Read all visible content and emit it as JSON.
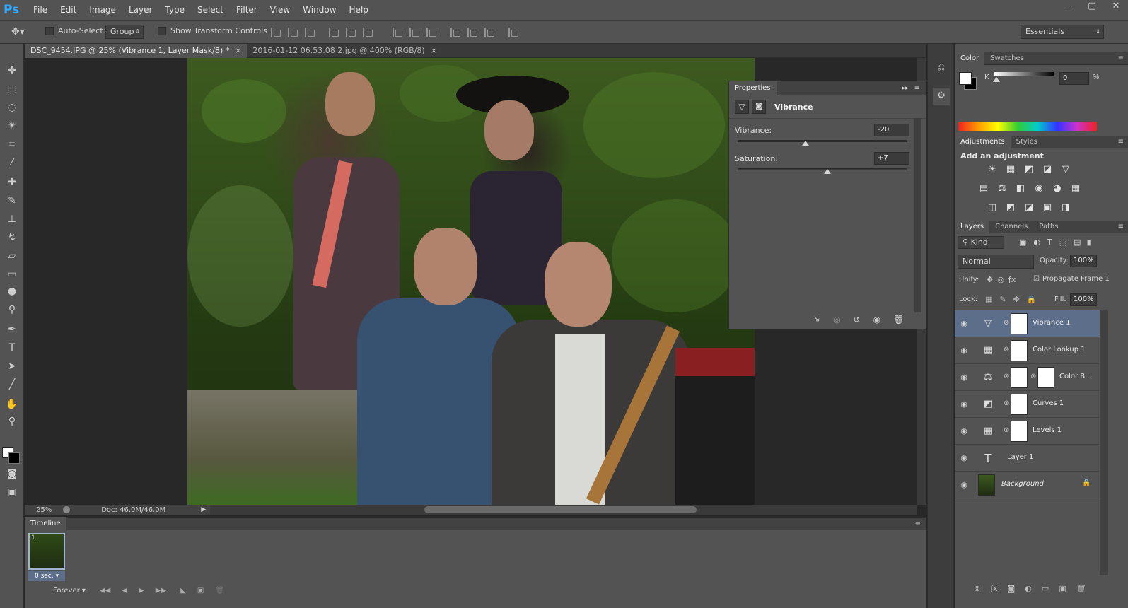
{
  "app": {
    "logo": "Ps"
  },
  "menu": [
    "File",
    "Edit",
    "Image",
    "Layer",
    "Type",
    "Select",
    "Filter",
    "View",
    "Window",
    "Help"
  ],
  "window_controls": {
    "minimize": "–",
    "restore": "▢",
    "close": "✕"
  },
  "options_bar": {
    "auto_select_label": "Auto-Select:",
    "auto_select_value": "Group",
    "show_transform_label": "Show Transform Controls",
    "workspace": "Essentials"
  },
  "documents": [
    {
      "title": "DSC_9454.JPG @ 25% (Vibrance 1, Layer Mask/8) *",
      "active": true
    },
    {
      "title": "2016-01-12 06.53.08 2.jpg @ 400% (RGB/8)",
      "active": false
    }
  ],
  "status": {
    "zoom": "25%",
    "doc": "Doc: 46.0M/46.0M"
  },
  "properties": {
    "tab": "Properties",
    "title": "Vibrance",
    "vibrance_label": "Vibrance:",
    "vibrance_value": "-20",
    "saturation_label": "Saturation:",
    "saturation_value": "+7"
  },
  "timeline": {
    "tab": "Timeline",
    "frame_number": "1",
    "frame_delay": "0 sec.",
    "loop": "Forever"
  },
  "color_panel": {
    "tabs": [
      "Color",
      "Swatches"
    ],
    "channel_label": "K",
    "channel_value": "0",
    "unit": "%"
  },
  "adjustments_panel": {
    "tabs": [
      "Adjustments",
      "Styles"
    ],
    "heading": "Add an adjustment",
    "row1": [
      "☀",
      "▦",
      "◩",
      "◪",
      "▽"
    ],
    "row2": [
      "▤",
      "⚖",
      "◧",
      "◉",
      "◕",
      "▦"
    ],
    "row3": [
      "◫",
      "◩",
      "◪",
      "▣",
      "◨"
    ]
  },
  "layers_panel": {
    "tabs": [
      "Layers",
      "Channels",
      "Paths"
    ],
    "filter_kind": "Kind",
    "blend_mode": "Normal",
    "opacity_label": "Opacity:",
    "opacity_value": "100%",
    "unify_label": "Unify:",
    "propagate_label": "Propagate Frame 1",
    "lock_label": "Lock:",
    "fill_label": "Fill:",
    "fill_value": "100%",
    "layers": [
      {
        "name": "Vibrance 1",
        "icon": "▽",
        "selected": true
      },
      {
        "name": "Color Lookup 1",
        "icon": "▦",
        "selected": false
      },
      {
        "name": "Color B...",
        "icon": "⚖",
        "selected": false
      },
      {
        "name": "Curves 1",
        "icon": "◩",
        "selected": false
      },
      {
        "name": "Levels 1",
        "icon": "▦",
        "selected": false
      },
      {
        "name": "Layer 1",
        "icon": "T",
        "selected": false
      },
      {
        "name": "Background",
        "icon": "",
        "selected": false
      }
    ]
  }
}
